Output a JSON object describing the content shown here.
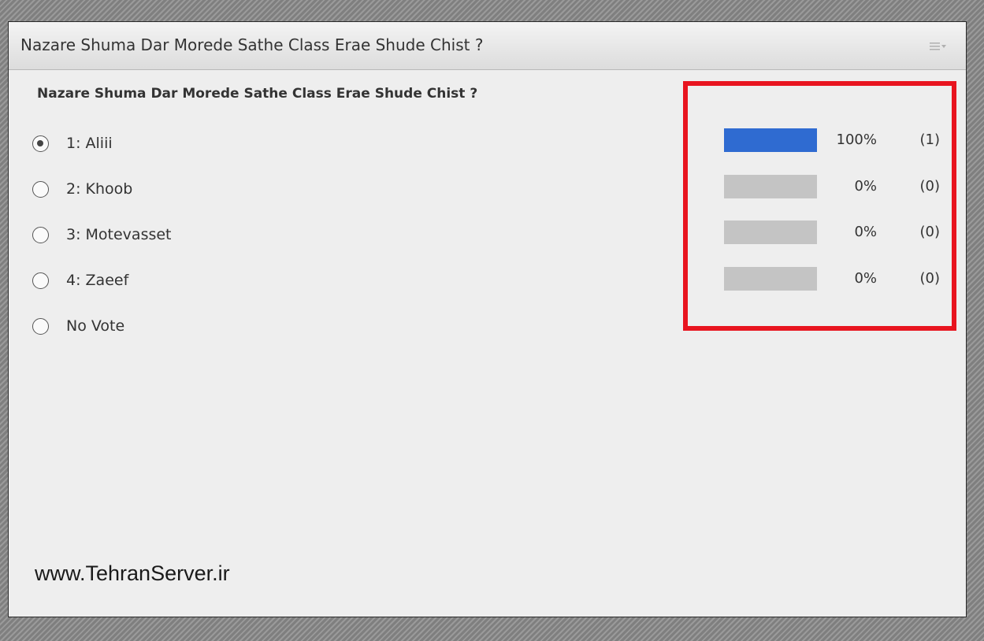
{
  "window": {
    "title": "Nazare Shuma Dar Morede Sathe Class Erae Shude Chist ?",
    "menu_icon": "options-menu-icon"
  },
  "poll": {
    "question": "Nazare Shuma Dar Morede Sathe Class Erae Shude Chist ?",
    "options": [
      {
        "label": "1: Aliii",
        "selected": true
      },
      {
        "label": "2: Khoob",
        "selected": false
      },
      {
        "label": "3: Motevasset",
        "selected": false
      },
      {
        "label": "4: Zaeef",
        "selected": false
      },
      {
        "label": "No Vote",
        "selected": false
      }
    ],
    "results": [
      {
        "percent_label": "100%",
        "count_label": "(1)",
        "fraction": 1.0
      },
      {
        "percent_label": "0%",
        "count_label": "(0)",
        "fraction": 0
      },
      {
        "percent_label": "0%",
        "count_label": "(0)",
        "fraction": 0
      },
      {
        "percent_label": "0%",
        "count_label": "(0)",
        "fraction": 0
      }
    ]
  },
  "colors": {
    "bar_fill": "#2f6bd1",
    "bar_track": "#c4c4c4",
    "highlight": "#e8141f"
  },
  "watermark": "www.TehranServer.ir"
}
